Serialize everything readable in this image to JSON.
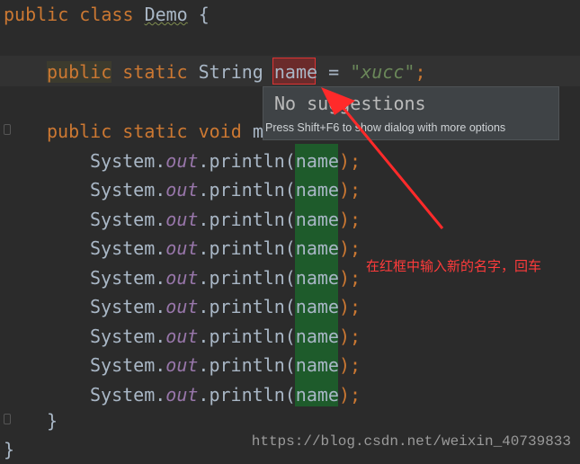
{
  "code": {
    "line1": {
      "public": "public",
      "class": "class",
      "name": "Demo",
      "brace": "{"
    },
    "line2": {
      "public": "public",
      "static": "static",
      "type": "String",
      "var": "name",
      "eq": "=",
      "value": "\"xucc\"",
      "semi": ";"
    },
    "line3": {
      "public": "public",
      "static": "static",
      "void": "void",
      "method": "m"
    },
    "println_lines": [
      {
        "obj": "System.",
        "field": "out",
        "method": ".println(",
        "arg": "name",
        "end": ");"
      },
      {
        "obj": "System.",
        "field": "out",
        "method": ".println(",
        "arg": "name",
        "end": ");"
      },
      {
        "obj": "System.",
        "field": "out",
        "method": ".println(",
        "arg": "name",
        "end": ");"
      },
      {
        "obj": "System.",
        "field": "out",
        "method": ".println(",
        "arg": "name",
        "end": ");"
      },
      {
        "obj": "System.",
        "field": "out",
        "method": ".println(",
        "arg": "name",
        "end": ");"
      },
      {
        "obj": "System.",
        "field": "out",
        "method": ".println(",
        "arg": "name",
        "end": ");"
      },
      {
        "obj": "System.",
        "field": "out",
        "method": ".println(",
        "arg": "name",
        "end": ");"
      },
      {
        "obj": "System.",
        "field": "out",
        "method": ".println(",
        "arg": "name",
        "end": ");"
      },
      {
        "obj": "System.",
        "field": "out",
        "method": ".println(",
        "arg": "name",
        "end": ");"
      }
    ],
    "close_inner": "}",
    "close_outer": "}"
  },
  "popup": {
    "title": "No suggestions",
    "hint": "Press Shift+F6 to show dialog with more options"
  },
  "annotation": "在红框中输入新的名字，回车",
  "watermark": "https://blog.csdn.net/weixin_40739833",
  "colors": {
    "background": "#2b2b2b",
    "keyword": "#cc7832",
    "string": "#6a8759",
    "field": "#9876aa",
    "rename_box": "#dd3333",
    "usage_highlight": "#1e5b2b",
    "annotation": "#ff3b3b"
  }
}
